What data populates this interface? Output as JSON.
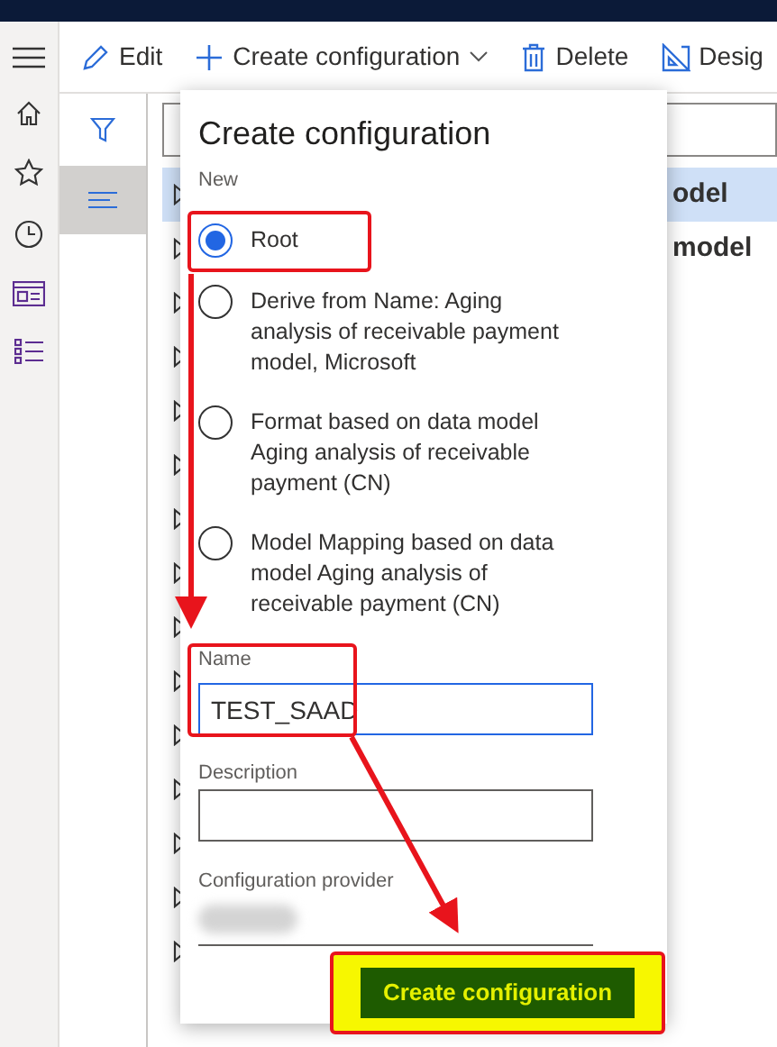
{
  "toolbar": {
    "items": [
      {
        "kind": "edit",
        "label": "Edit"
      },
      {
        "kind": "create",
        "label": "Create configuration"
      },
      {
        "kind": "delete",
        "label": "Delete"
      },
      {
        "kind": "design",
        "label": "Desig"
      }
    ]
  },
  "tree": {
    "rows": [
      {
        "label": "odel",
        "selected": true,
        "expanded": false
      },
      {
        "label": "model",
        "selected": false,
        "expanded": false
      },
      {
        "selected": false,
        "expanded": false
      },
      {
        "selected": false,
        "expanded": false
      },
      {
        "selected": false,
        "expanded": false
      },
      {
        "selected": false,
        "expanded": false
      },
      {
        "selected": false,
        "expanded": false
      },
      {
        "selected": false,
        "expanded": false
      },
      {
        "selected": false,
        "expanded": false
      },
      {
        "selected": false,
        "expanded": false
      },
      {
        "selected": false,
        "expanded": false
      },
      {
        "selected": false,
        "expanded": false
      },
      {
        "selected": false,
        "expanded": false
      },
      {
        "selected": false,
        "expanded": false
      },
      {
        "selected": false,
        "expanded": false
      }
    ]
  },
  "dialog": {
    "title": "Create configuration",
    "group_label": "New",
    "options": [
      {
        "label": "Root",
        "selected": true
      },
      {
        "label": "Derive from Name: Aging analysis of receivable payment model, Microsoft",
        "selected": false
      },
      {
        "label": "Format based on data model Aging analysis of receivable payment (CN)",
        "selected": false
      },
      {
        "label": "Model Mapping based on data model Aging analysis of receivable payment (CN)",
        "selected": false
      }
    ],
    "name_field": {
      "label": "Name",
      "value": "TEST_SAAD"
    },
    "description_field": {
      "label": "Description"
    },
    "provider_field": {
      "label": "Configuration provider"
    },
    "submit": "Create configuration"
  }
}
